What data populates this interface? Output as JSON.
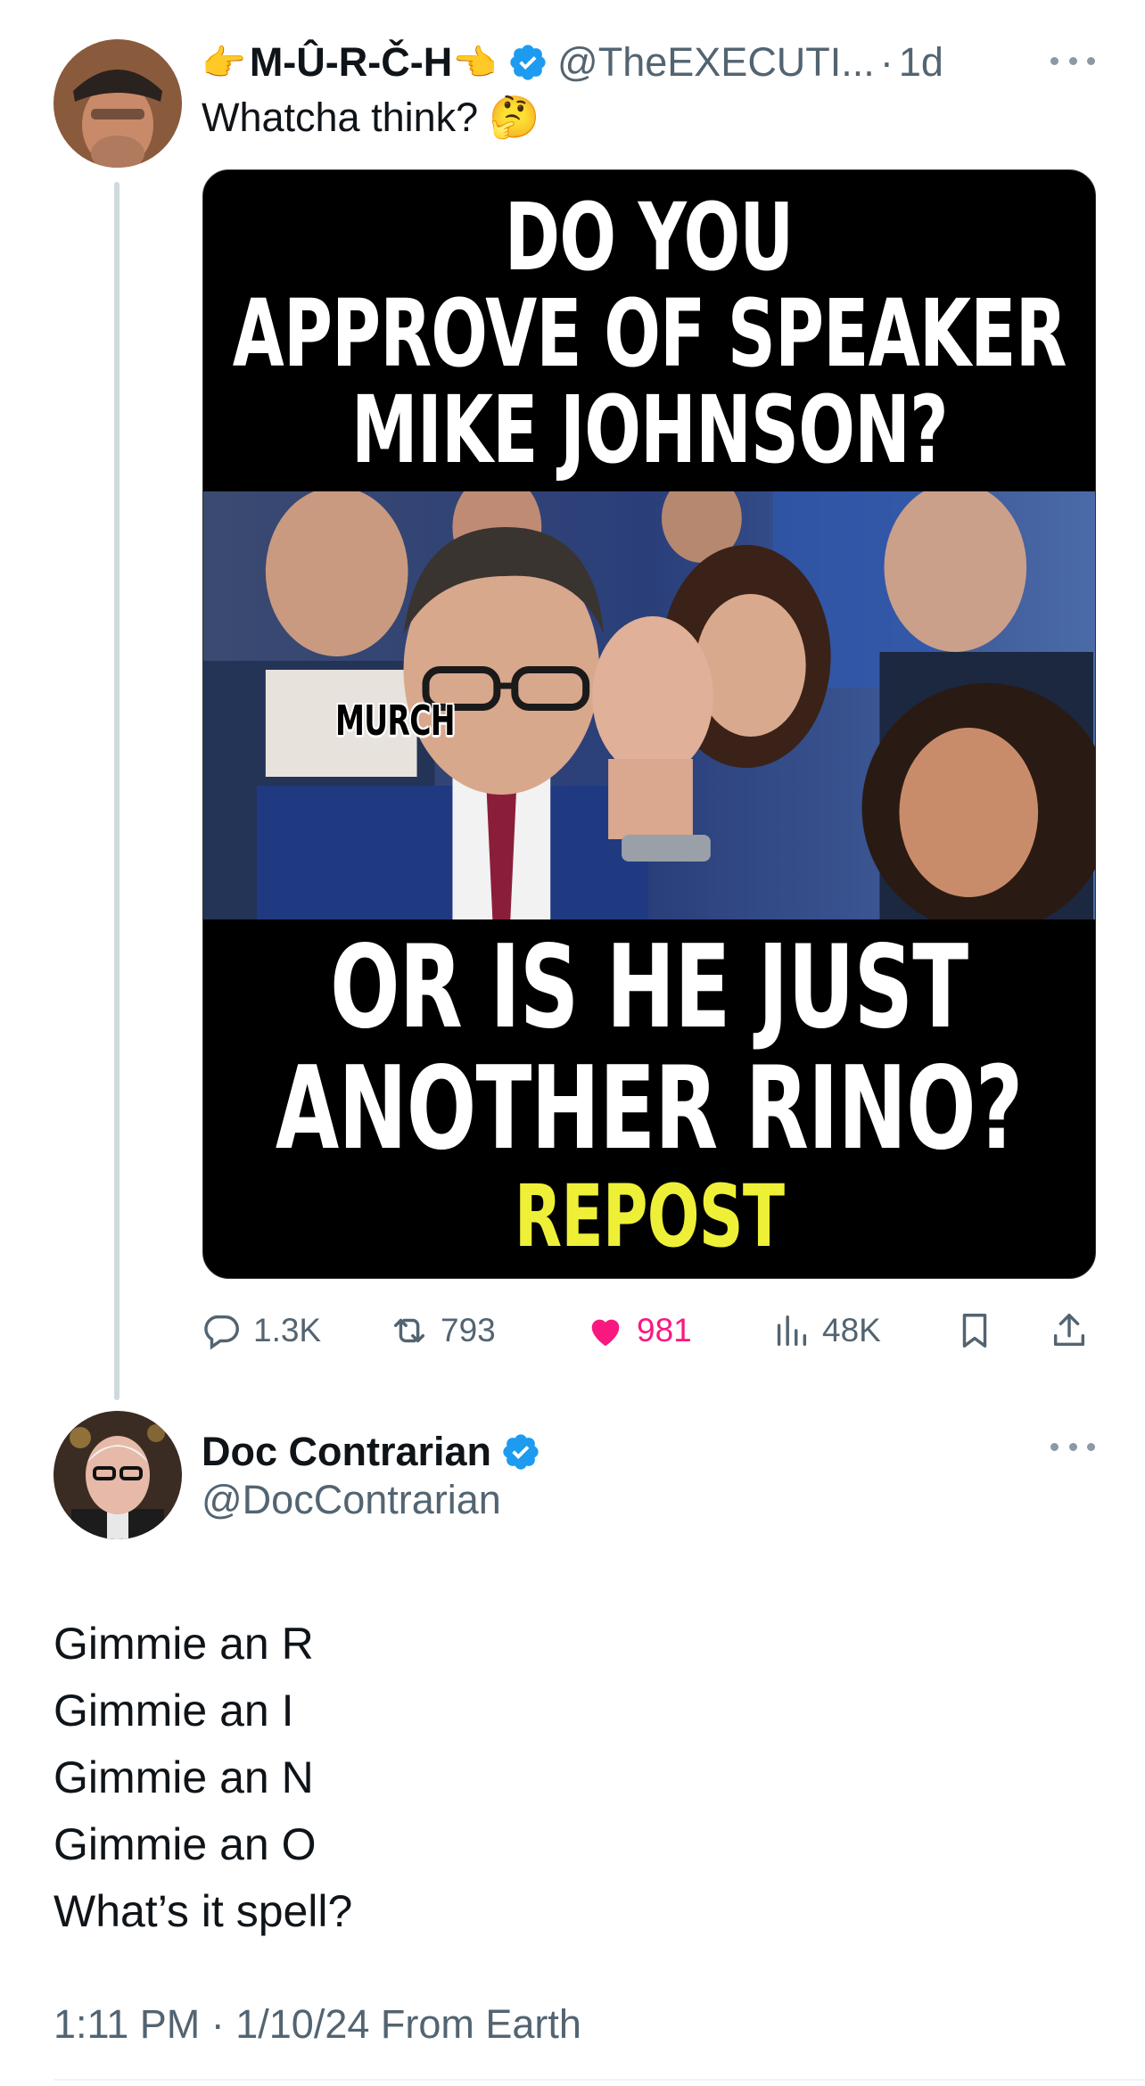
{
  "tweet": {
    "display_name": "M-Û-R-Č-H",
    "handle": "@TheEXECUTI...",
    "separator": "·",
    "time_ago": "1d",
    "text": "Whatcha think?",
    "icons": {
      "left_hand": "pointing-right-hand-icon",
      "right_hand": "pointing-left-hand-icon",
      "verified": "verified-badge-icon",
      "emoji": "thinking-face-icon"
    },
    "media": {
      "top_lines": [
        "DO YOU",
        "APPROVE OF SPEAKER",
        "MIKE JOHNSON?"
      ],
      "watermark": "MURCH",
      "bottom_lines": [
        "OR IS HE JUST",
        "ANOTHER RINO?"
      ],
      "callout": "REPOST"
    },
    "stats": {
      "replies": "1.3K",
      "reposts": "793",
      "likes": "981",
      "views": "48K"
    }
  },
  "reply": {
    "display_name": "Doc Contrarian",
    "handle": "@DocContrarian",
    "lines": [
      "Gimmie an R",
      "Gimmie an I",
      "Gimmie an N",
      "Gimmie an O",
      "What’s it spell?"
    ],
    "timestamp": "1:11 PM · 1/10/24 From Earth"
  },
  "colors": {
    "verified": "#1d9bf0",
    "like": "#f91880",
    "secondary_text": "#536471",
    "callout_yellow": "#eef037"
  }
}
